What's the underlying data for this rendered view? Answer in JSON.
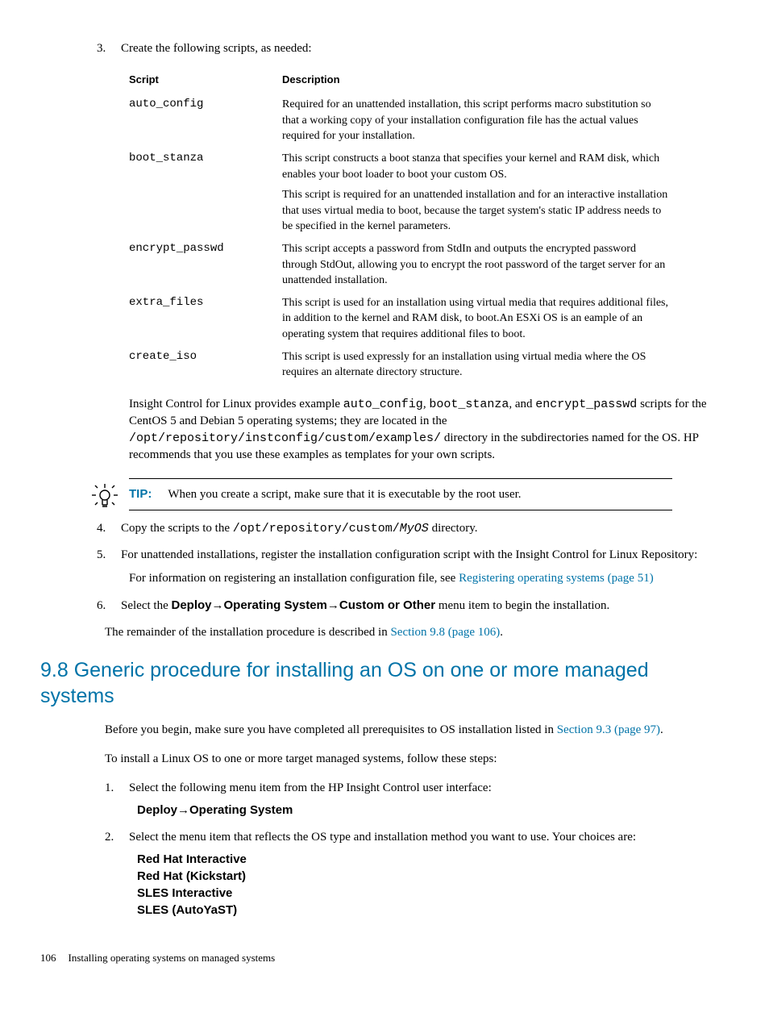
{
  "step3": {
    "number": "3.",
    "text": "Create the following scripts, as needed:"
  },
  "table": {
    "headers": {
      "script": "Script",
      "description": "Description"
    },
    "rows": [
      {
        "name": "auto_config",
        "desc1": "Required for an unattended installation, this script performs macro substitution so that a working copy of your installation configuration file has the actual values required for your installation."
      },
      {
        "name": "boot_stanza",
        "desc1": "This script constructs a boot stanza that specifies your kernel and RAM disk, which enables your boot loader to boot your custom OS.",
        "desc2": "This script is required for an unattended installation and for an interactive installation that uses virtual media to boot, because the target system's static IP address needs to be specified in the kernel parameters."
      },
      {
        "name": "encrypt_passwd",
        "desc1": "This script accepts a password from StdIn and outputs the encrypted password through StdOut, allowing you to encrypt the root password of the target server for an unattended installation."
      },
      {
        "name": "extra_files",
        "desc1": "This script is used for an installation using virtual media that requires additional files, in addition to the kernel and RAM disk, to boot.An ESXi OS is an eample of an operating system that requires additional files to boot."
      },
      {
        "name": "create_iso",
        "desc1": "This script is used expressly for an installation using virtual media where the OS requires an alternate directory structure."
      }
    ]
  },
  "follow": {
    "p1a": "Insight Control for Linux provides example ",
    "p1_code1": "auto_config",
    "p1b": ", ",
    "p1_code2": "boot_stanza",
    "p1c": ", and ",
    "p1_code3": "encrypt_passwd",
    "p1d": " scripts for the CentOS 5 and Debian 5 operating systems; they are located in the ",
    "p1_code4": "/opt/repository/instconfig/custom/examples/",
    "p1e": " directory in the subdirectories named for the OS. HP recommends that you use these examples as templates for your own scripts."
  },
  "tip": {
    "label": "TIP:",
    "text": "When you create a script, make sure that it is executable by the root user."
  },
  "step4": {
    "number": "4.",
    "text_a": "Copy the scripts to the ",
    "code1": "/opt/repository/custom/",
    "code2": "MyOS",
    "text_b": " directory."
  },
  "step5": {
    "number": "5.",
    "text": "For unattended installations, register the installation configuration script with the Insight Control for Linux Repository:",
    "sub_a": "For information on registering an installation configuration file, see ",
    "link": "Registering operating systems (page 51)"
  },
  "step6": {
    "number": "6.",
    "text_a": "Select the ",
    "b1": "Deploy",
    "arrow": "→",
    "b2": "Operating System",
    "b3": "Custom or Other",
    "text_b": " menu item to begin the installation."
  },
  "remainder": {
    "text_a": "The remainder of the installation procedure is described in ",
    "link": "Section 9.8 (page 106)",
    "text_b": "."
  },
  "heading": "9.8 Generic procedure for installing an OS on one or more managed systems",
  "section": {
    "p1_a": "Before you begin, make sure you have completed all prerequisites to OS installation listed in ",
    "p1_link": "Section 9.3 (page 97)",
    "p1_b": ".",
    "p2": "To install a Linux OS to one or more target managed systems, follow these steps:",
    "s1_num": "1.",
    "s1_text": "Select the following menu item from the HP Insight Control user interface:",
    "s1_b1": "Deploy",
    "s1_arrow": "→",
    "s1_b2": "Operating System",
    "s2_num": "2.",
    "s2_text": "Select the menu item that reflects the OS type and installation method you want to use. Your choices are:",
    "choices": [
      "Red Hat Interactive",
      "Red Hat (Kickstart)",
      "SLES Interactive",
      "SLES (AutoYaST)"
    ]
  },
  "footer": {
    "page": "106",
    "title": "Installing operating systems on managed systems"
  }
}
